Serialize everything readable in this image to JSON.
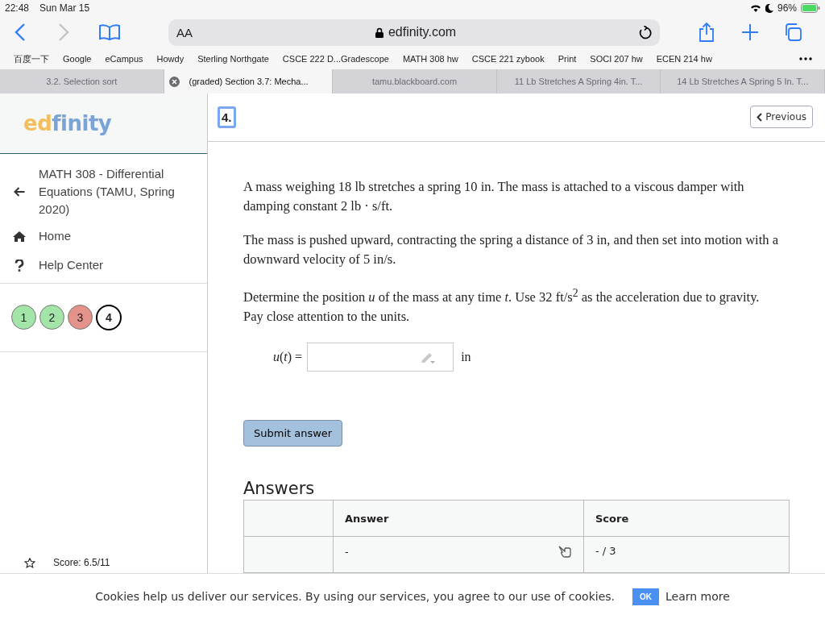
{
  "status_bar": {
    "time": "22:48",
    "date": "Sun Mar 15",
    "battery": "96%"
  },
  "address_bar": {
    "text_size": "AA",
    "url": "edfinity.com"
  },
  "bookmarks": [
    "百度一下",
    "Google",
    "eCampus",
    "Howdy",
    "Sterling Northgate",
    "CSCE 222 D...Gradescope",
    "MATH 308 hw",
    "CSCE 221 zybook",
    "Print",
    "SOCI 207 hw",
    "ECEN 214 hw"
  ],
  "tabs": [
    {
      "label": "3.2. Selection sort",
      "selected": false
    },
    {
      "label": "(graded) Section 3.7: Mecha...",
      "selected": true
    },
    {
      "label": "tamu.blackboard.com",
      "selected": false
    },
    {
      "label": "11 Lb Stretches A Spring 4in. T...",
      "selected": false
    },
    {
      "label": "14 Lb Stretches A Spring 5 In. T...",
      "selected": false
    }
  ],
  "sidebar": {
    "logo": [
      "ed",
      "finity"
    ],
    "course": "MATH 308 - Differential Equations (TAMU, Spring 2020)",
    "items": [
      {
        "kind": "home",
        "label": "Home"
      },
      {
        "kind": "help",
        "label": "Help Center"
      }
    ],
    "questions": [
      {
        "label": "1",
        "color": "#a3e4a8",
        "selected": false
      },
      {
        "label": "2",
        "color": "#a3e4a8",
        "selected": false
      },
      {
        "label": "3",
        "color": "#e4938a",
        "selected": false
      },
      {
        "label": "4",
        "color": "#ffffff",
        "selected": true
      }
    ],
    "score": "Score: 6.5/11"
  },
  "problem": {
    "number": "4.",
    "previous": "Previous",
    "paragraphs": [
      "A mass weighing 18 lb stretches a spring 10 in. The mass is attached to a viscous damper with damping constant 2 lb · s/ft.",
      "The mass is pushed upward, contracting the spring a distance of 3 in, and then set into motion with a downward velocity of 5 in/s.",
      "Determine the position *u* of the mass at any time *t*. Use 32 ft/s$^{2}$ as the acceleration due to gravity. Pay close attention to the units."
    ],
    "answer_label": "*u*(*t*) =",
    "unit": "in",
    "submit": "Submit answer"
  },
  "answers": {
    "title": "Answers",
    "columns": [
      "Answer",
      "Score"
    ],
    "rows": [
      {
        "answer": "-",
        "score": "- / 3"
      }
    ]
  },
  "cookie_bar": {
    "text": "Cookies help us deliver our services. By using our services, you agree to our use of cookies.",
    "ok": "OK",
    "learn_more": "Learn more"
  }
}
